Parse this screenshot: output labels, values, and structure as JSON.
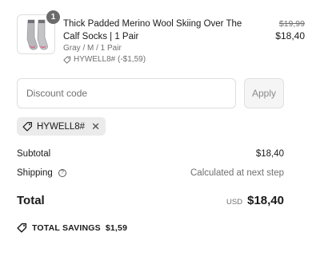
{
  "product": {
    "quantity": "1",
    "title": "Thick Padded Merino Wool Skiing Over The Calf Socks | 1 Pair",
    "variant": "Gray / M / 1 Pair",
    "discount_tag": "HYWELL8# (-$1,59)",
    "original_price": "$19,99",
    "price": "$18,40",
    "image_icon": "socks-icon"
  },
  "discount": {
    "placeholder": "Discount code",
    "apply_label": "Apply",
    "applied_code": "HYWELL8#"
  },
  "summary": {
    "subtotal_label": "Subtotal",
    "subtotal_value": "$18,40",
    "shipping_label": "Shipping",
    "shipping_value": "Calculated at next step",
    "total_label": "Total",
    "currency": "USD",
    "total_value": "$18,40",
    "savings_label": "TOTAL SAVINGS",
    "savings_value": "$1,59"
  },
  "colors": {
    "text": "#1a1a1a",
    "muted": "#707070",
    "chip_bg": "#ebebeb",
    "badge_bg": "#6b6b6b"
  }
}
